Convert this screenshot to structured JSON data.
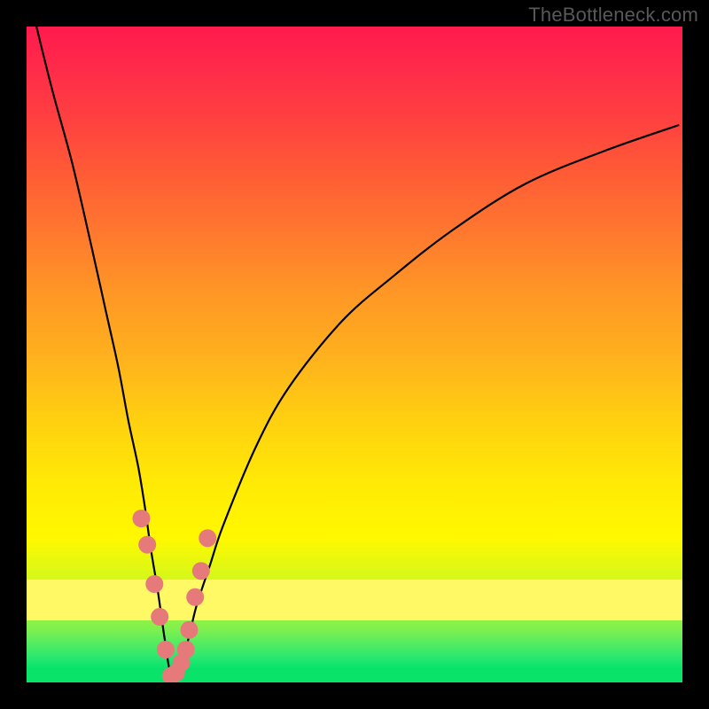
{
  "watermark": "TheBottleneck.com",
  "chart_data": {
    "type": "line",
    "title": "",
    "xlabel": "",
    "ylabel": "",
    "xlim": [
      0,
      100
    ],
    "ylim": [
      0,
      100
    ],
    "grid": false,
    "legend": false,
    "note": "Axes have no visible tick labels. Values below are read from pixel positions; x and y are normalized 0–100 across the plot area. The curve is a V shape: steep descent from upper-left to a minimum near x≈22, then a concave rise to the right edge.",
    "series": [
      {
        "name": "curve",
        "x": [
          1.5,
          4,
          7,
          10,
          12,
          14,
          15.5,
          17,
          18,
          19,
          20,
          21,
          22,
          23,
          24,
          25,
          26,
          28,
          30,
          35,
          40,
          48,
          56,
          65,
          76,
          88,
          99.5
        ],
        "y": [
          100,
          90,
          79,
          66,
          57,
          48,
          40,
          33,
          27,
          20,
          14,
          7,
          1,
          1,
          4,
          8,
          12,
          18,
          24,
          36,
          45,
          55,
          62,
          69,
          76,
          81,
          85
        ]
      }
    ],
    "markers": {
      "name": "highlighted-dots",
      "x": [
        17.5,
        18.4,
        19.5,
        20.3,
        21.2,
        22.0,
        22.8,
        23.6,
        24.3,
        24.8,
        25.7,
        26.6,
        27.6
      ],
      "y": [
        25,
        21,
        15,
        10,
        5,
        1,
        1.5,
        3,
        5,
        8,
        13,
        17,
        22
      ]
    }
  }
}
